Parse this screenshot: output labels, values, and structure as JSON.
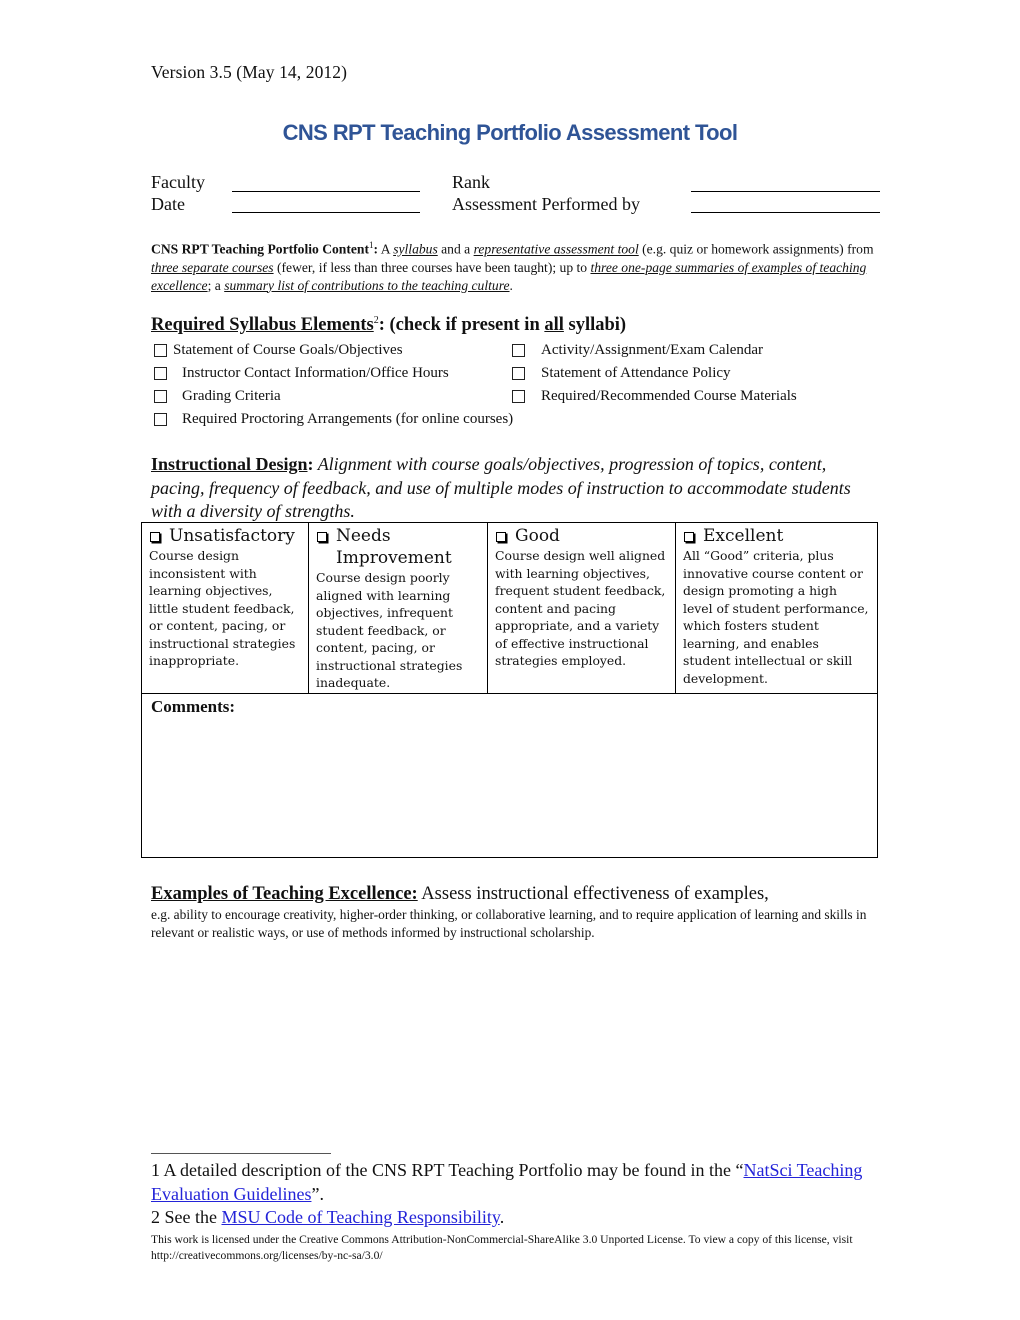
{
  "version": "Version 3.5 (May 14, 2012)",
  "title": "CNS RPT Teaching Portfolio Assessment Tool",
  "colors": {
    "title": "#2f5496",
    "link": "#2323d8",
    "text": "#111111"
  },
  "header_fields": {
    "faculty": {
      "label": "Faculty",
      "value": ""
    },
    "rank": {
      "label": "Rank",
      "value": ""
    },
    "date": {
      "label": "Date",
      "value": ""
    },
    "assessor": {
      "label": "Assessment Performed by",
      "value": ""
    }
  },
  "portfolio_content": {
    "label": "CNS RPT Teaching Portfolio Content",
    "footnote_ref": "1",
    "colon": ":",
    "t1": " A ",
    "syllabus": "syllabus",
    "t2": " and a ",
    "assessment_tool": "representative assessment tool",
    "t3": " (e.g. quiz or homework assignments) from ",
    "three_courses": "three separate courses",
    "t4": " (fewer, if less than three courses have been taught); up to ",
    "summaries": "three one-page summaries of examples of teaching excellence",
    "t5": "; a ",
    "contributions": "summary list of contributions to the teaching culture",
    "t6": "."
  },
  "syllabus_elements": {
    "heading_label": "Required Syllabus Elements",
    "footnote_ref": "2",
    "heading_pre": ": (check if present in ",
    "heading_all": "all",
    "heading_post": " syllabi)",
    "items": [
      {
        "label": "Statement of Course Goals/Objectives",
        "checked": false
      },
      {
        "label": "Activity/Assignment/Exam Calendar",
        "checked": false
      },
      {
        "label": "Instructor Contact Information/Office Hours",
        "checked": false
      },
      {
        "label": "Statement of Attendance Policy",
        "checked": false
      },
      {
        "label": "Grading Criteria",
        "checked": false
      },
      {
        "label": "Required/Recommended Course Materials",
        "checked": false
      },
      {
        "label": "Required Proctoring Arrangements (for online courses)",
        "checked": false
      }
    ]
  },
  "instructional_design": {
    "label": "Instructional Design",
    "colon": ":",
    "description": " Alignment with course goals/objectives, progression of topics, content, pacing, frequency of feedback, and use of multiple modes of instruction to accommodate students with a diversity of strengths.",
    "ratings": [
      {
        "label": "Unsatisfactory",
        "checked": false,
        "description": "Course design inconsistent with learning objectives, little student feedback, or content, pacing, or instructional strategies inappropriate."
      },
      {
        "label": "Needs Improvement",
        "checked": false,
        "description": "Course design poorly aligned with learning objectives, infrequent student feedback, or content, pacing, or instructional strategies inadequate."
      },
      {
        "label": "Good",
        "checked": false,
        "description": "Course design well aligned with learning objectives, frequent student feedback, content and pacing appropriate, and a variety of effective instructional strategies employed."
      },
      {
        "label": "Excellent",
        "checked": false,
        "description": "All “Good” criteria, plus innovative course content or design promoting a high level of student performance, which fosters student learning, and enables student intellectual or skill development."
      }
    ],
    "comments_label": "Comments:",
    "comments_value": ""
  },
  "teaching_excellence": {
    "label": "Examples of Teaching Excellence:",
    "lead": " Assess instructional effectiveness of examples,",
    "detail": "e.g. ability to encourage creativity, higher-order thinking, or collaborative learning, and to require application of learning and skills in relevant or realistic ways, or use of methods informed by instructional scholarship."
  },
  "footnotes": {
    "fn1_pre": "1 A detailed description of the CNS RPT Teaching Portfolio may be found in the “",
    "fn1_link": "NatSci Teaching Evaluation Guidelines",
    "fn1_post": "”.",
    "fn2_pre": "2 See the ",
    "fn2_link": "MSU Code of Teaching Responsibility",
    "fn2_post": ".",
    "license": "This work is licensed under the Creative Commons Attribution-NonCommercial-ShareAlike 3.0 Unported License. To view a copy of this license, visit http://creativecommons.org/licenses/by-nc-sa/3.0/"
  }
}
